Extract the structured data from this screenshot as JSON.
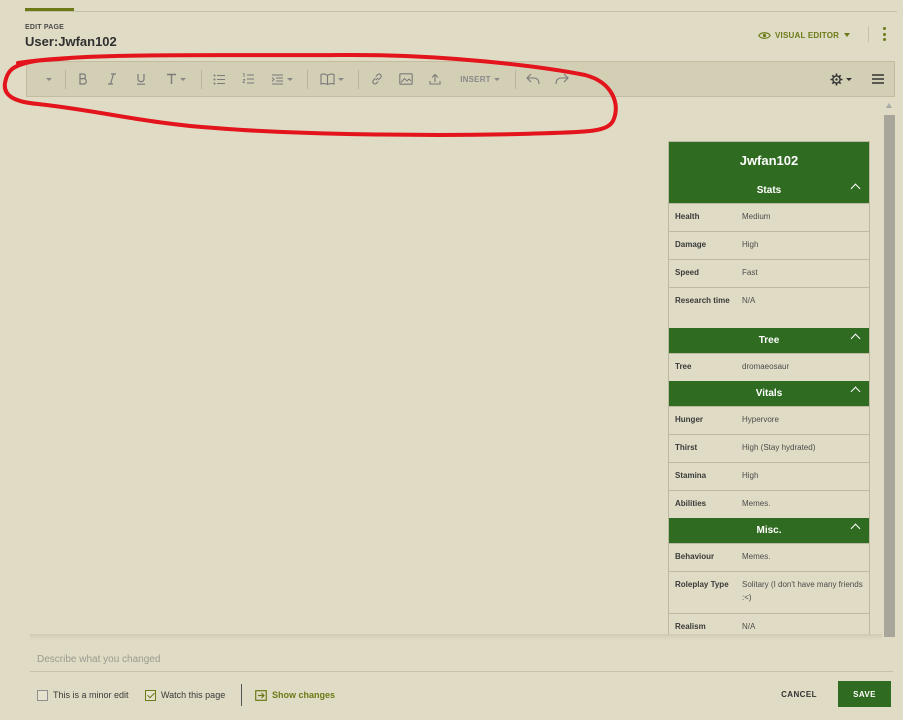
{
  "header": {
    "edit_label": "EDIT PAGE",
    "page_title": "User:Jwfan102",
    "editor_mode_label": "VISUAL EDITOR"
  },
  "toolbar": {
    "buttons": [
      {
        "name": "paragraph-format-dropdown",
        "icon": "chevron-down-icon"
      },
      {
        "name": "bold-button",
        "icon": "bold-icon"
      },
      {
        "name": "italic-button",
        "icon": "italic-icon"
      },
      {
        "name": "underline-button",
        "icon": "underline-icon"
      },
      {
        "name": "text-style-dropdown",
        "icon": "text-style-icon"
      },
      {
        "name": "bullet-list-button",
        "icon": "bullet-list-icon"
      },
      {
        "name": "numbered-list-button",
        "icon": "numbered-list-icon"
      },
      {
        "name": "indent-dropdown",
        "icon": "indent-icon"
      },
      {
        "name": "cite-dropdown",
        "icon": "book-icon"
      },
      {
        "name": "link-button",
        "icon": "link-icon"
      },
      {
        "name": "media-button",
        "icon": "image-icon"
      },
      {
        "name": "upload-button",
        "icon": "upload-icon"
      },
      {
        "name": "undo-button",
        "icon": "undo-icon"
      },
      {
        "name": "redo-button",
        "icon": "redo-icon"
      },
      {
        "name": "page-settings-dropdown",
        "icon": "gear-icon"
      },
      {
        "name": "page-options-menu",
        "icon": "hamburger-menu-icon"
      }
    ],
    "insert_label": "INSERT"
  },
  "infobox": {
    "title": "Jwfan102",
    "sections": [
      {
        "header": "Stats",
        "rows": [
          {
            "key": "Health",
            "value": "Medium"
          },
          {
            "key": "Damage",
            "value": "High"
          },
          {
            "key": "Speed",
            "value": "Fast"
          },
          {
            "key": "Research time",
            "value": "N/A"
          }
        ]
      },
      {
        "header": "Tree",
        "rows": [
          {
            "key": "Tree",
            "value": "dromaeosaur"
          }
        ]
      },
      {
        "header": "Vitals",
        "rows": [
          {
            "key": "Hunger",
            "value": "Hypervore"
          },
          {
            "key": "Thirst",
            "value": "High (Stay hydrated)"
          },
          {
            "key": "Stamina",
            "value": "High"
          },
          {
            "key": "Abilities",
            "value": "Memes."
          }
        ]
      },
      {
        "header": "Misc.",
        "rows": [
          {
            "key": "Behaviour",
            "value": "Memes."
          },
          {
            "key": "Roleplay Type",
            "value": "Solitary (I don't have many friends :<)"
          },
          {
            "key": "Realism",
            "value": "N/A"
          }
        ]
      }
    ]
  },
  "footer": {
    "summary_placeholder": "Describe what you changed",
    "minor_edit_label": "This is a minor edit",
    "minor_edit_checked": false,
    "watch_label": "Watch this page",
    "watch_checked": true,
    "show_changes_label": "Show changes",
    "cancel_label": "CANCEL",
    "save_label": "SAVE"
  },
  "colors": {
    "accent": "#6b7a16",
    "infobox_header": "#2f6b20",
    "background": "#dfdbc4",
    "annotation_stroke": "#e3141b"
  }
}
